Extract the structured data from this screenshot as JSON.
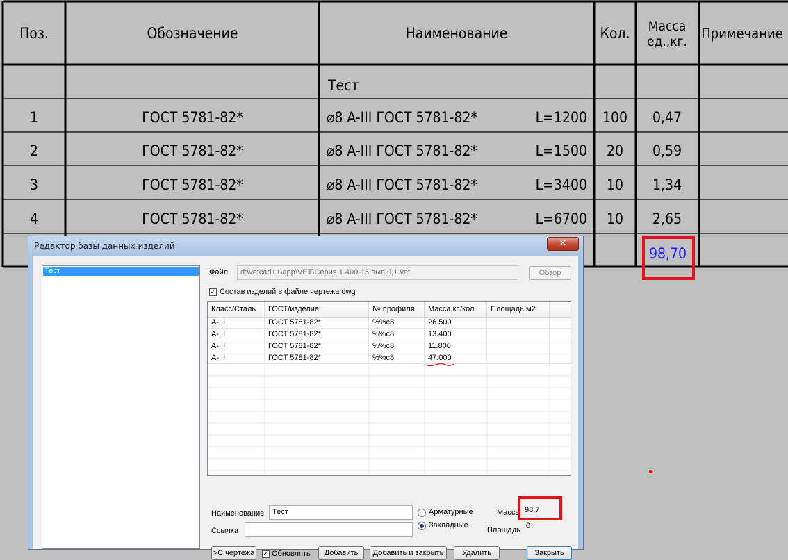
{
  "spec_table": {
    "headers": {
      "pos": "Поз.",
      "designation": "Обозначение",
      "name": "Наименование",
      "qty": "Кол.",
      "mass_line1": "Масса",
      "mass_line2": "ед.,кг.",
      "note": "Примечание"
    },
    "group_title": "Тест",
    "rows": [
      {
        "pos": "1",
        "designation": "ГОСТ 5781-82*",
        "name": "⌀8 A-III ГОСТ 5781-82*",
        "length": "L=1200",
        "qty": "100",
        "mass": "0,47"
      },
      {
        "pos": "2",
        "designation": "ГОСТ 5781-82*",
        "name": "⌀8 A-III ГОСТ 5781-82*",
        "length": "L=1500",
        "qty": "20",
        "mass": "0,59"
      },
      {
        "pos": "3",
        "designation": "ГОСТ 5781-82*",
        "name": "⌀8 A-III ГОСТ 5781-82*",
        "length": "L=3400",
        "qty": "10",
        "mass": "1,34"
      },
      {
        "pos": "4",
        "designation": "ГОСТ 5781-82*",
        "name": "⌀8 A-III ГОСТ 5781-82*",
        "length": "L=6700",
        "qty": "10",
        "mass": "2,65"
      }
    ],
    "total_mass": "98,70"
  },
  "dialog": {
    "title": "Редактор базы данных изделий",
    "close_glyph": "✕",
    "tree_items": [
      "Тест"
    ],
    "file_label": "Файл",
    "file_path": "d:\\vetcad++\\app\\VET\\Серия 1.400-15 вып.0,1.vet",
    "browse_button": "Обзор",
    "compose_checkbox_label": "Состав изделий в файле чертежа dwg",
    "grid_columns": [
      "Класс/Сталь",
      "ГОСТ/изделие",
      "№ профиля",
      "Масса,кг./кол.",
      "Площадь,м2"
    ],
    "grid_rows": [
      [
        "A-III",
        "ГОСТ 5781-82*",
        "%%c8",
        "26.500",
        ""
      ],
      [
        "A-III",
        "ГОСТ 5781-82*",
        "%%c8",
        "13.400",
        ""
      ],
      [
        "A-III",
        "ГОСТ 5781-82*",
        "%%c8",
        "11.800",
        ""
      ],
      [
        "A-III",
        "ГОСТ 5781-82*",
        "%%c8",
        "47.000",
        ""
      ]
    ],
    "name_label": "Наименование",
    "name_value": "Тест",
    "link_label": "Ссылка",
    "link_value": "",
    "radio_rebar": "Арматурные",
    "radio_embedded": "Закладные",
    "mass_label": "Масса",
    "mass_value": "98.7",
    "area_label": "Площадь",
    "area_value": "0",
    "from_drawing_button": ">С чертежа",
    "update_checkbox_label": "Обновлять",
    "add_button": "Добавить",
    "add_close_button": "Добавить и закрыть",
    "delete_button": "Удалить",
    "close_button": "Закрыть"
  },
  "colors": {
    "highlight_red": "#e0131a",
    "total_blue": "#1a1aff",
    "selection_blue": "#3399ff"
  }
}
